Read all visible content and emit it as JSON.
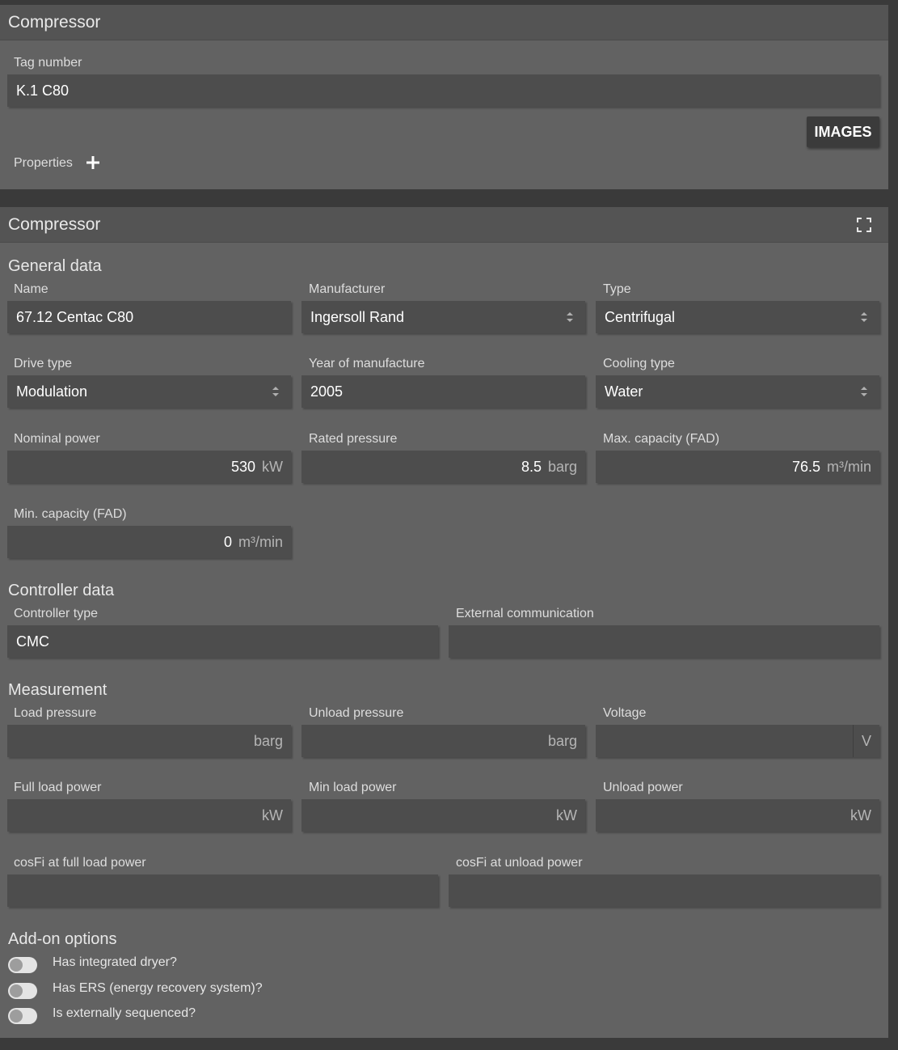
{
  "panel1": {
    "title": "Compressor",
    "tag_label": "Tag number",
    "tag_value": "K.1 C80",
    "images_button": "IMAGES",
    "properties_label": "Properties"
  },
  "panel2": {
    "title": "Compressor",
    "general": {
      "heading": "General data",
      "name_label": "Name",
      "name_value": "67.12 Centac C80",
      "manufacturer_label": "Manufacturer",
      "manufacturer_value": "Ingersoll Rand",
      "type_label": "Type",
      "type_value": "Centrifugal",
      "drive_label": "Drive type",
      "drive_value": "Modulation",
      "year_label": "Year of manufacture",
      "year_value": "2005",
      "cooling_label": "Cooling type",
      "cooling_value": "Water",
      "nominal_power_label": "Nominal power",
      "nominal_power_value": "530",
      "nominal_power_unit": "kW",
      "rated_pressure_label": "Rated pressure",
      "rated_pressure_value": "8.5",
      "rated_pressure_unit": "barg",
      "max_capacity_label": "Max. capacity (FAD)",
      "max_capacity_value": "76.5",
      "max_capacity_unit": "m³/min",
      "min_capacity_label": "Min. capacity (FAD)",
      "min_capacity_value": "0",
      "min_capacity_unit": "m³/min"
    },
    "controller": {
      "heading": "Controller data",
      "type_label": "Controller type",
      "type_value": "CMC",
      "external_label": "External communication",
      "external_value": ""
    },
    "measurement": {
      "heading": "Measurement",
      "load_pressure_label": "Load pressure",
      "load_pressure_unit": "barg",
      "unload_pressure_label": "Unload pressure",
      "unload_pressure_unit": "barg",
      "voltage_label": "Voltage",
      "voltage_unit": "V",
      "full_load_power_label": "Full load power",
      "full_load_power_unit": "kW",
      "min_load_power_label": "Min load power",
      "min_load_power_unit": "kW",
      "unload_power_label": "Unload power",
      "unload_power_unit": "kW",
      "cosfi_full_label": "cosFi at full load power",
      "cosfi_unload_label": "cosFi at unload power"
    },
    "addons": {
      "heading": "Add-on options",
      "options": [
        {
          "label": "Has integrated dryer?",
          "on": false
        },
        {
          "label": "Has ERS (energy recovery system)?",
          "on": false
        },
        {
          "label": "Is externally sequenced?",
          "on": false
        }
      ]
    }
  }
}
